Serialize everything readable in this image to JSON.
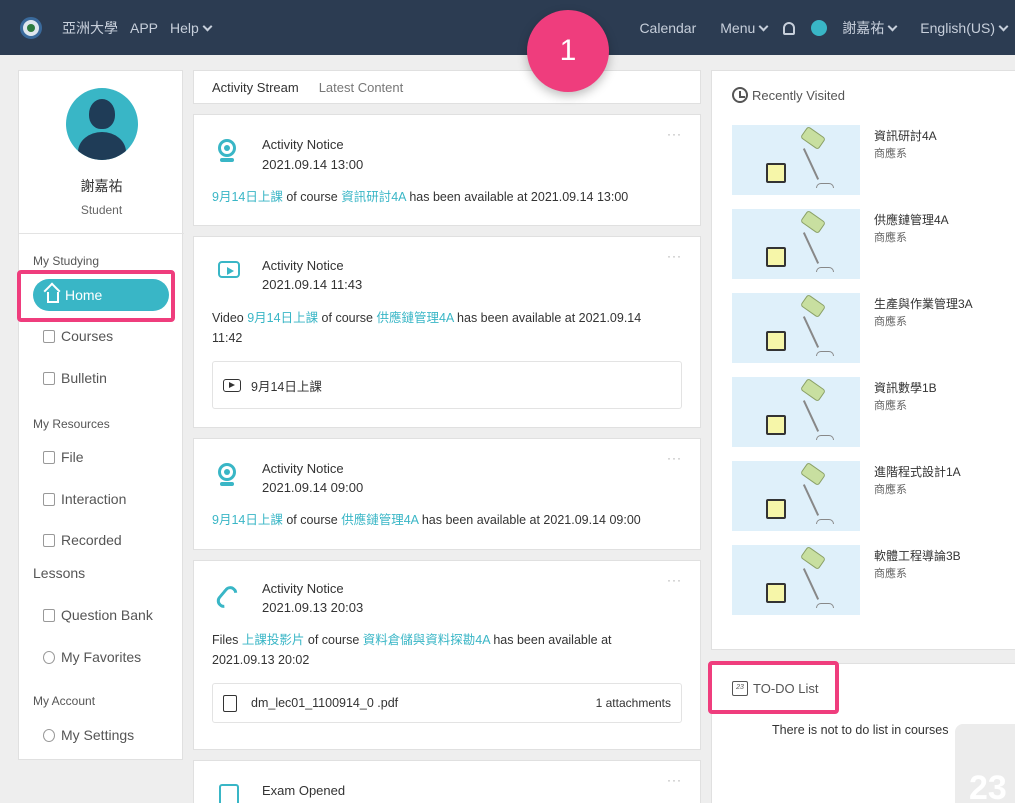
{
  "topbar": {
    "school": "亞洲大學",
    "app": "APP",
    "help": "Help",
    "calendar": "Calendar",
    "menu": "Menu",
    "user": "謝嘉祐",
    "language": "English(US)"
  },
  "badge": "1",
  "sidebar": {
    "name": "謝嘉祐",
    "role": "Student",
    "section_studying": "My Studying",
    "home": "Home",
    "courses": "Courses",
    "bulletin": "Bulletin",
    "section_resources": "My Resources",
    "file": "File",
    "interaction": "Interaction",
    "recorded": "Recorded",
    "lessons": "Lessons",
    "question_bank": "Question Bank",
    "favorites": "My Favorites",
    "section_account": "My Account",
    "settings": "My Settings"
  },
  "tabs": {
    "stream": "Activity Stream",
    "latest": "Latest Content"
  },
  "feed": {
    "more": "···",
    "c1": {
      "title": "Activity Notice",
      "time": "2021.09.14 13:00",
      "l1": "9月14日上課",
      "t1": " of course ",
      "l2": "資訊研討4A",
      "t2": " has been available at 2021.09.14 13:00"
    },
    "c2": {
      "title": "Activity Notice",
      "time": "2021.09.14 11:43",
      "t0": "Video ",
      "l1": "9月14日上課",
      "t1": " of course ",
      "l2": "供應鏈管理4A",
      "t2": " has been available at 2021.09.14 11:42",
      "item": "9月14日上課"
    },
    "c3": {
      "title": "Activity Notice",
      "time": "2021.09.14 09:00",
      "l1": "9月14日上課",
      "t1": " of course ",
      "l2": "供應鏈管理4A",
      "t2": " has been available at 2021.09.14 09:00"
    },
    "c4": {
      "title": "Activity Notice",
      "time": "2021.09.13 20:03",
      "t0": "Files ",
      "l1": "上課投影片",
      "t1": " of course ",
      "l2": "資料倉儲與資料探勘4A",
      "t2": " has been available at 2021.09.13 20:02",
      "file": "dm_lec01_1100914_0 .pdf",
      "attach": "1 attachments"
    },
    "c5": {
      "title": "Exam Opened"
    }
  },
  "recent": {
    "title": "Recently Visited",
    "items": [
      {
        "name": "資訊研討4A",
        "dept": "商應系"
      },
      {
        "name": "供應鏈管理4A",
        "dept": "商應系"
      },
      {
        "name": "生產與作業管理3A",
        "dept": "商應系"
      },
      {
        "name": "資訊數學1B",
        "dept": "商應系"
      },
      {
        "name": "進階程式設計1A",
        "dept": "商應系"
      },
      {
        "name": "軟體工程導論3B",
        "dept": "商應系"
      }
    ]
  },
  "todo": {
    "title": "TO-DO List",
    "icon_num": "23",
    "empty": "There is not to do list in courses",
    "big_num": "23"
  },
  "colors": {
    "accent": "#39b6c6",
    "highlight": "#ef3d7d",
    "topbar": "#2c3c52"
  }
}
